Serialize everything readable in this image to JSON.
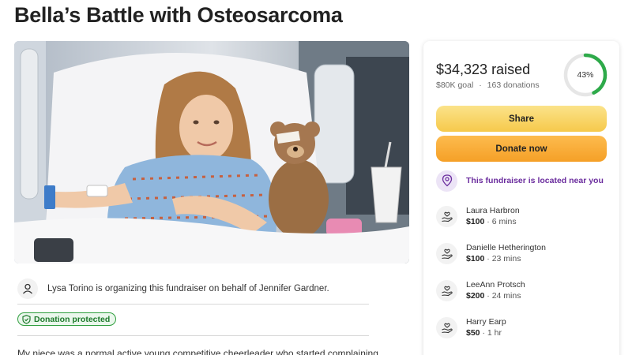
{
  "page": {
    "title": "Bella’s Battle with Osteosarcoma"
  },
  "organizer": {
    "text": "Lysa Torino is organizing this fundraiser on behalf of Jennifer Gardner.",
    "icon": "person-icon"
  },
  "badge": {
    "label": "Donation protected",
    "icon": "shield-icon"
  },
  "story": {
    "excerpt": "My niece was a normal active young competitive cheerleader who started complaining of"
  },
  "summary": {
    "raised": "$34,323 raised",
    "goal": "$80K goal",
    "separator": "·",
    "donations": "163 donations",
    "progress_label": "43%",
    "progress_fraction": 0.43,
    "progress_color": "#2eaa4a",
    "track_color": "#e6e6e6"
  },
  "buttons": {
    "share": "Share",
    "donate": "Donate now"
  },
  "location": {
    "text": "This fundraiser is located near you",
    "icon": "location-pin-icon",
    "color": "#6b2d9e"
  },
  "donors": [
    {
      "name": "Laura Harbron",
      "amount": "$100",
      "time": "6 mins"
    },
    {
      "name": "Danielle Hetherington",
      "amount": "$100",
      "time": "23 mins"
    },
    {
      "name": "LeeAnn Protsch",
      "amount": "$200",
      "time": "24 mins"
    },
    {
      "name": "Harry Earp",
      "amount": "$50",
      "time": "1 hr"
    }
  ]
}
